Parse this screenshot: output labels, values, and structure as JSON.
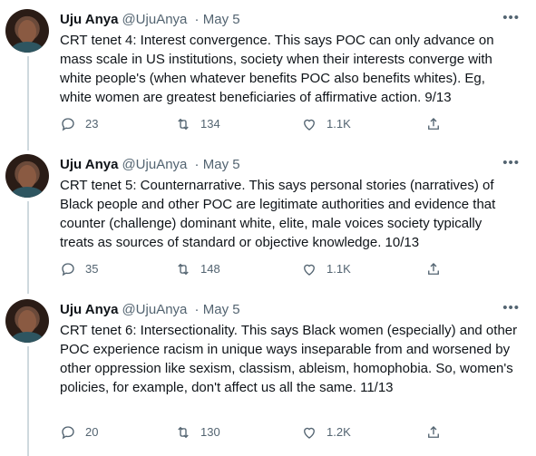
{
  "tweets": [
    {
      "author_name": "Uju Anya",
      "handle": "@UjuAnya",
      "date": "May 5",
      "text": "CRT tenet 4: Interest convergence. This says POC can only advance on mass scale in US institutions, society when their interests converge with white people's (when whatever benefits POC also benefits whites). Eg, white women are greatest beneficiaries of affirmative action. 9/13",
      "replies": "23",
      "retweets": "134",
      "likes": "1.1K"
    },
    {
      "author_name": "Uju Anya",
      "handle": "@UjuAnya",
      "date": "May 5",
      "text": "CRT tenet 5: Counternarrative. This says personal stories (narratives) of Black people and other POC are legitimate authorities and evidence that counter (challenge) dominant white, elite, male voices society typically treats as sources of standard or objective knowledge. 10/13",
      "replies": "35",
      "retweets": "148",
      "likes": "1.1K"
    },
    {
      "author_name": "Uju Anya",
      "handle": "@UjuAnya",
      "date": "May 5",
      "text": "CRT tenet 6: Intersectionality. This says Black women (especially) and other POC experience racism in unique ways inseparable from and worsened by other oppression like sexism, classism, ableism, homophobia. So, women's policies, for example, don't affect us all the same. 11/13",
      "replies": "20",
      "retweets": "130",
      "likes": "1.2K"
    }
  ],
  "icons": {
    "reply": "reply-icon",
    "retweet": "retweet-icon",
    "like": "like-icon",
    "share": "share-icon",
    "more": "more-icon"
  },
  "colors": {
    "text": "#0f1419",
    "secondary": "#536471",
    "thread_line": "#cfd9de"
  }
}
